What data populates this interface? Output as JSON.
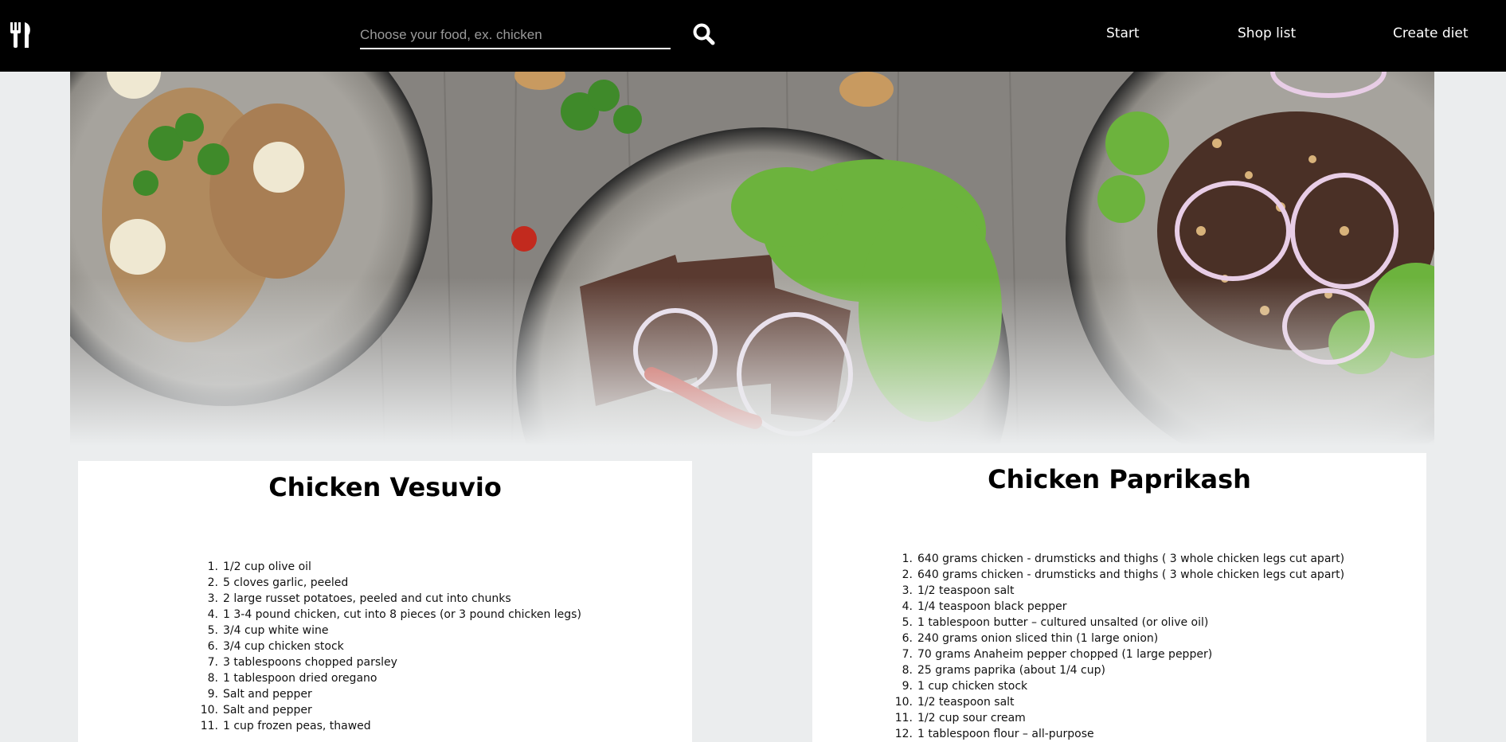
{
  "navbar": {
    "logo_icon": "fork-knife-icon",
    "search": {
      "placeholder": "Choose your food, ex. chicken",
      "value": "",
      "button_icon": "search-icon"
    },
    "links": [
      "Start",
      "Shop list",
      "Create diet"
    ]
  },
  "hero": {
    "image": "food-bowls-banner"
  },
  "recipes": [
    {
      "title": "Chicken Vesuvio",
      "ingredients": [
        "1/2 cup olive oil",
        "5 cloves garlic, peeled",
        "2 large russet potatoes, peeled and cut into chunks",
        "1 3-4 pound chicken, cut into 8 pieces (or 3 pound chicken legs)",
        "3/4 cup white wine",
        "3/4 cup chicken stock",
        "3 tablespoons chopped parsley",
        "1 tablespoon dried oregano",
        "Salt and pepper",
        "Salt and pepper",
        "1 cup frozen peas, thawed"
      ]
    },
    {
      "title": "Chicken Paprikash",
      "ingredients": [
        "640 grams chicken - drumsticks and thighs ( 3 whole chicken legs cut apart)",
        "640 grams chicken - drumsticks and thighs ( 3 whole chicken legs cut apart)",
        "1/2 teaspoon salt",
        "1/4 teaspoon black pepper",
        "1 tablespoon butter – cultured unsalted (or olive oil)",
        "240 grams onion sliced thin (1 large onion)",
        "70 grams Anaheim pepper chopped (1 large pepper)",
        "25 grams paprika (about 1/4 cup)",
        "1 cup chicken stock",
        "1/2 teaspoon salt",
        "1/2 cup sour cream",
        "1 tablespoon flour – all-purpose"
      ]
    }
  ]
}
